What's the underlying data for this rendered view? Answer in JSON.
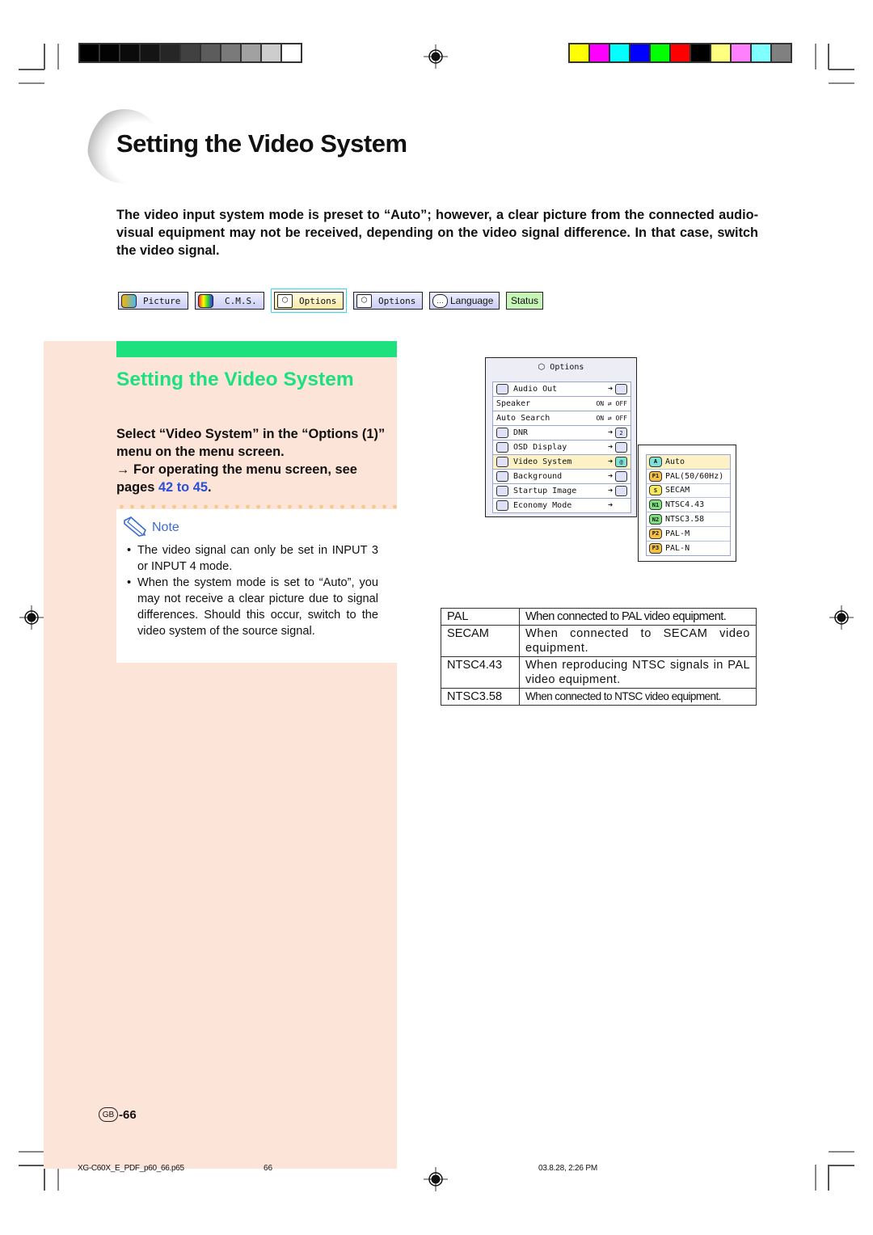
{
  "calibration": {
    "grayscale": [
      "#000000",
      "#030303",
      "#0b0b0b",
      "#141414",
      "#262626",
      "#414141",
      "#5c5c5c",
      "#7a7a7a",
      "#a1a1a1",
      "#cdcdcd",
      "#ffffff"
    ],
    "colors": [
      "#ffff00",
      "#ff00ff",
      "#00ffff",
      "#0000ff",
      "#00ff00",
      "#ff0000",
      "#000000",
      "#ffff80",
      "#ff80ff",
      "#80ffff",
      "#808080"
    ]
  },
  "page": {
    "title": "Setting the Video System",
    "intro": "The video input system mode is preset to “Auto”; however, a clear picture from the connected audio-visual equipment may not be received, depending on the video signal difference. In that case, switch the video signal."
  },
  "menu_tabs": [
    {
      "label": "Picture",
      "icon": "picture-icon"
    },
    {
      "label": "C.M.S.",
      "icon": "cms-icon"
    },
    {
      "label": "Options",
      "icon": "options1-icon",
      "active": true
    },
    {
      "label": "Options",
      "icon": "options2-icon"
    },
    {
      "label": "Language",
      "icon": "speech-bubble-icon"
    },
    {
      "label": "Status",
      "icon": ""
    }
  ],
  "sidebar": {
    "heading": "Setting the Video System",
    "instruction": "Select “Video System” in the “Options (1)” menu on the menu screen.",
    "reference_prefix": "→ For operating the menu screen, see pages ",
    "reference_link": "42 to 45",
    "reference_suffix": ".",
    "note_title": "Note",
    "notes": [
      "The video signal can only be set in INPUT 3 or INPUT 4 mode.",
      "When the system mode is set to “Auto”, you may not receive a clear picture due to signal differences. Should this occur, switch to the video system of the source signal."
    ]
  },
  "osd_menu": {
    "title": "Options",
    "items": [
      {
        "label": "Audio Out",
        "value": "speaker"
      },
      {
        "label": "Speaker",
        "value": "ON ⇄ OFF"
      },
      {
        "label": "Auto Search",
        "value": "ON ⇄ OFF"
      },
      {
        "label": "DNR",
        "value": "2"
      },
      {
        "label": "OSD Display",
        "value": "osd"
      },
      {
        "label": "Video System",
        "value": "auto",
        "selected": true
      },
      {
        "label": "Background",
        "value": "bg"
      },
      {
        "label": "Startup Image",
        "value": "img"
      },
      {
        "label": "Economy Mode",
        "value": ""
      }
    ]
  },
  "video_system_submenu": [
    {
      "badge": "A",
      "label": "Auto",
      "selected": true,
      "color": "#7fe0d6"
    },
    {
      "badge": "P1",
      "label": "PAL(50/60Hz)",
      "color": "#f2c14a"
    },
    {
      "badge": "S",
      "label": "SECAM",
      "color": "#f6ea5c"
    },
    {
      "badge": "N1",
      "label": "NTSC4.43",
      "color": "#7fe07f"
    },
    {
      "badge": "N2",
      "label": "NTSC3.58",
      "color": "#7fe07f"
    },
    {
      "badge": "P2",
      "label": "PAL-M",
      "color": "#f2c14a"
    },
    {
      "badge": "P3",
      "label": "PAL-N",
      "color": "#f2c14a"
    }
  ],
  "signal_table": [
    {
      "system": "PAL",
      "description": "When connected to PAL video equipment."
    },
    {
      "system": "SECAM",
      "description": "When connected to SECAM video equipment."
    },
    {
      "system": "NTSC4.43",
      "description": "When reproducing NTSC signals in PAL video equipment."
    },
    {
      "system": "NTSC3.58",
      "description": "When connected to NTSC video equipment."
    }
  ],
  "footer": {
    "region_badge": "GB",
    "page_number": "-66",
    "filename": "XG-C60X_E_PDF_p60_66.p65",
    "sheet": "66",
    "timestamp": "03.8.28, 2:26 PM"
  }
}
